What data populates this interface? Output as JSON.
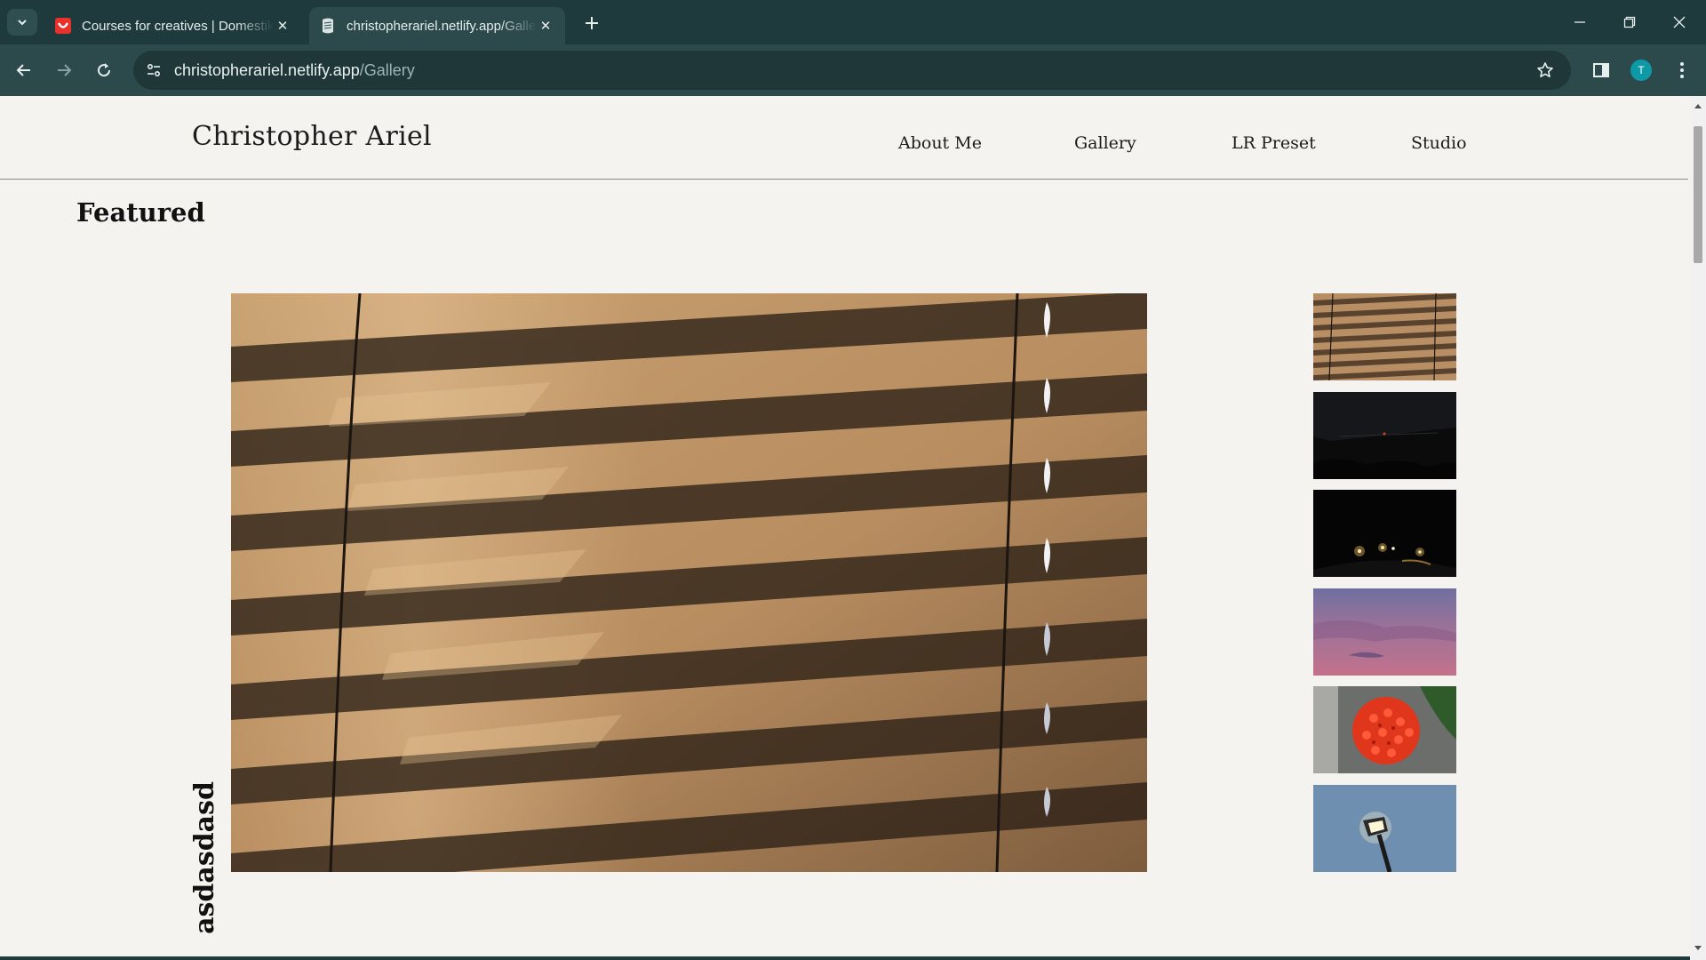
{
  "browser": {
    "tabs": [
      {
        "title": "Courses for creatives | Domestika",
        "favicon": "domestika-icon",
        "active": false
      },
      {
        "title": "christopherariel.netlify.app/Gallery",
        "favicon": "netlify-page-icon",
        "active": true
      }
    ],
    "url": {
      "host": "christopherariel.netlify.app",
      "path": "/Gallery"
    },
    "profile_initial": "T",
    "colors": {
      "frame": "#1e3a3c",
      "toolbar": "#2c4a4c",
      "omnibox": "#1f3739",
      "avatar": "#0d9aa6"
    }
  },
  "site": {
    "brand": "Christopher Ariel",
    "nav": [
      {
        "label": "About Me"
      },
      {
        "label": "Gallery"
      },
      {
        "label": "LR Preset"
      },
      {
        "label": "Studio"
      }
    ]
  },
  "featured": {
    "heading": "Featured",
    "caption": "asdasdasd",
    "main_photo": "window-blinds-photo",
    "thumbnails": [
      {
        "subject": "window-blinds-thumbnail"
      },
      {
        "subject": "dark-night-sky-thumbnail"
      },
      {
        "subject": "night-street-lights-thumbnail"
      },
      {
        "subject": "purple-sunset-clouds-thumbnail"
      },
      {
        "subject": "red-ixora-flower-thumbnail"
      },
      {
        "subject": "street-lamp-thumbnail"
      }
    ]
  },
  "page_colors": {
    "background": "#f4f3ef",
    "text": "#111111"
  }
}
